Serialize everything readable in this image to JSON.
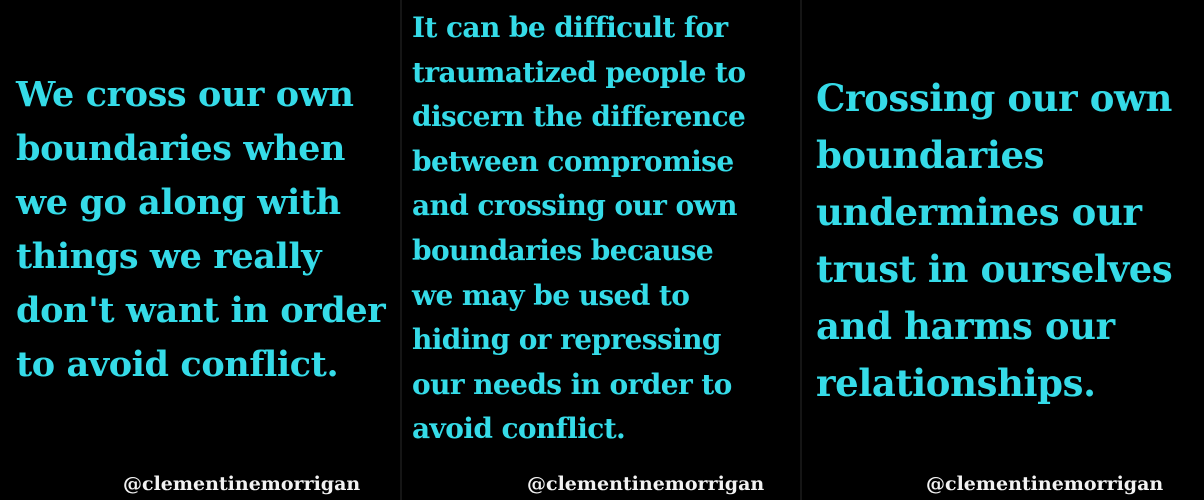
{
  "panels": [
    {
      "quote": "We cross our own\nboundaries when\nwe go along with\nthings we really\ndon't want in order\nto avoid conflict.",
      "handle": "@clementinemorrigan"
    },
    {
      "quote": "It can be difficult for\ntraumatized people to\ndiscern the difference\nbetween compromise\nand crossing our own\nboundaries because\nwe may be used to\nhiding or repressing\nour needs in order to\navoid conflict.",
      "handle": "@clementinemorrigan"
    },
    {
      "quote": "Crossing our own\nboundaries\nundermines our\ntrust in ourselves\nand harms our\nrelationships.",
      "handle": "@clementinemorrigan"
    }
  ],
  "colors": {
    "background": "#000000",
    "quote_text": "#35dbe8",
    "handle_text": "#f2f2f2"
  }
}
